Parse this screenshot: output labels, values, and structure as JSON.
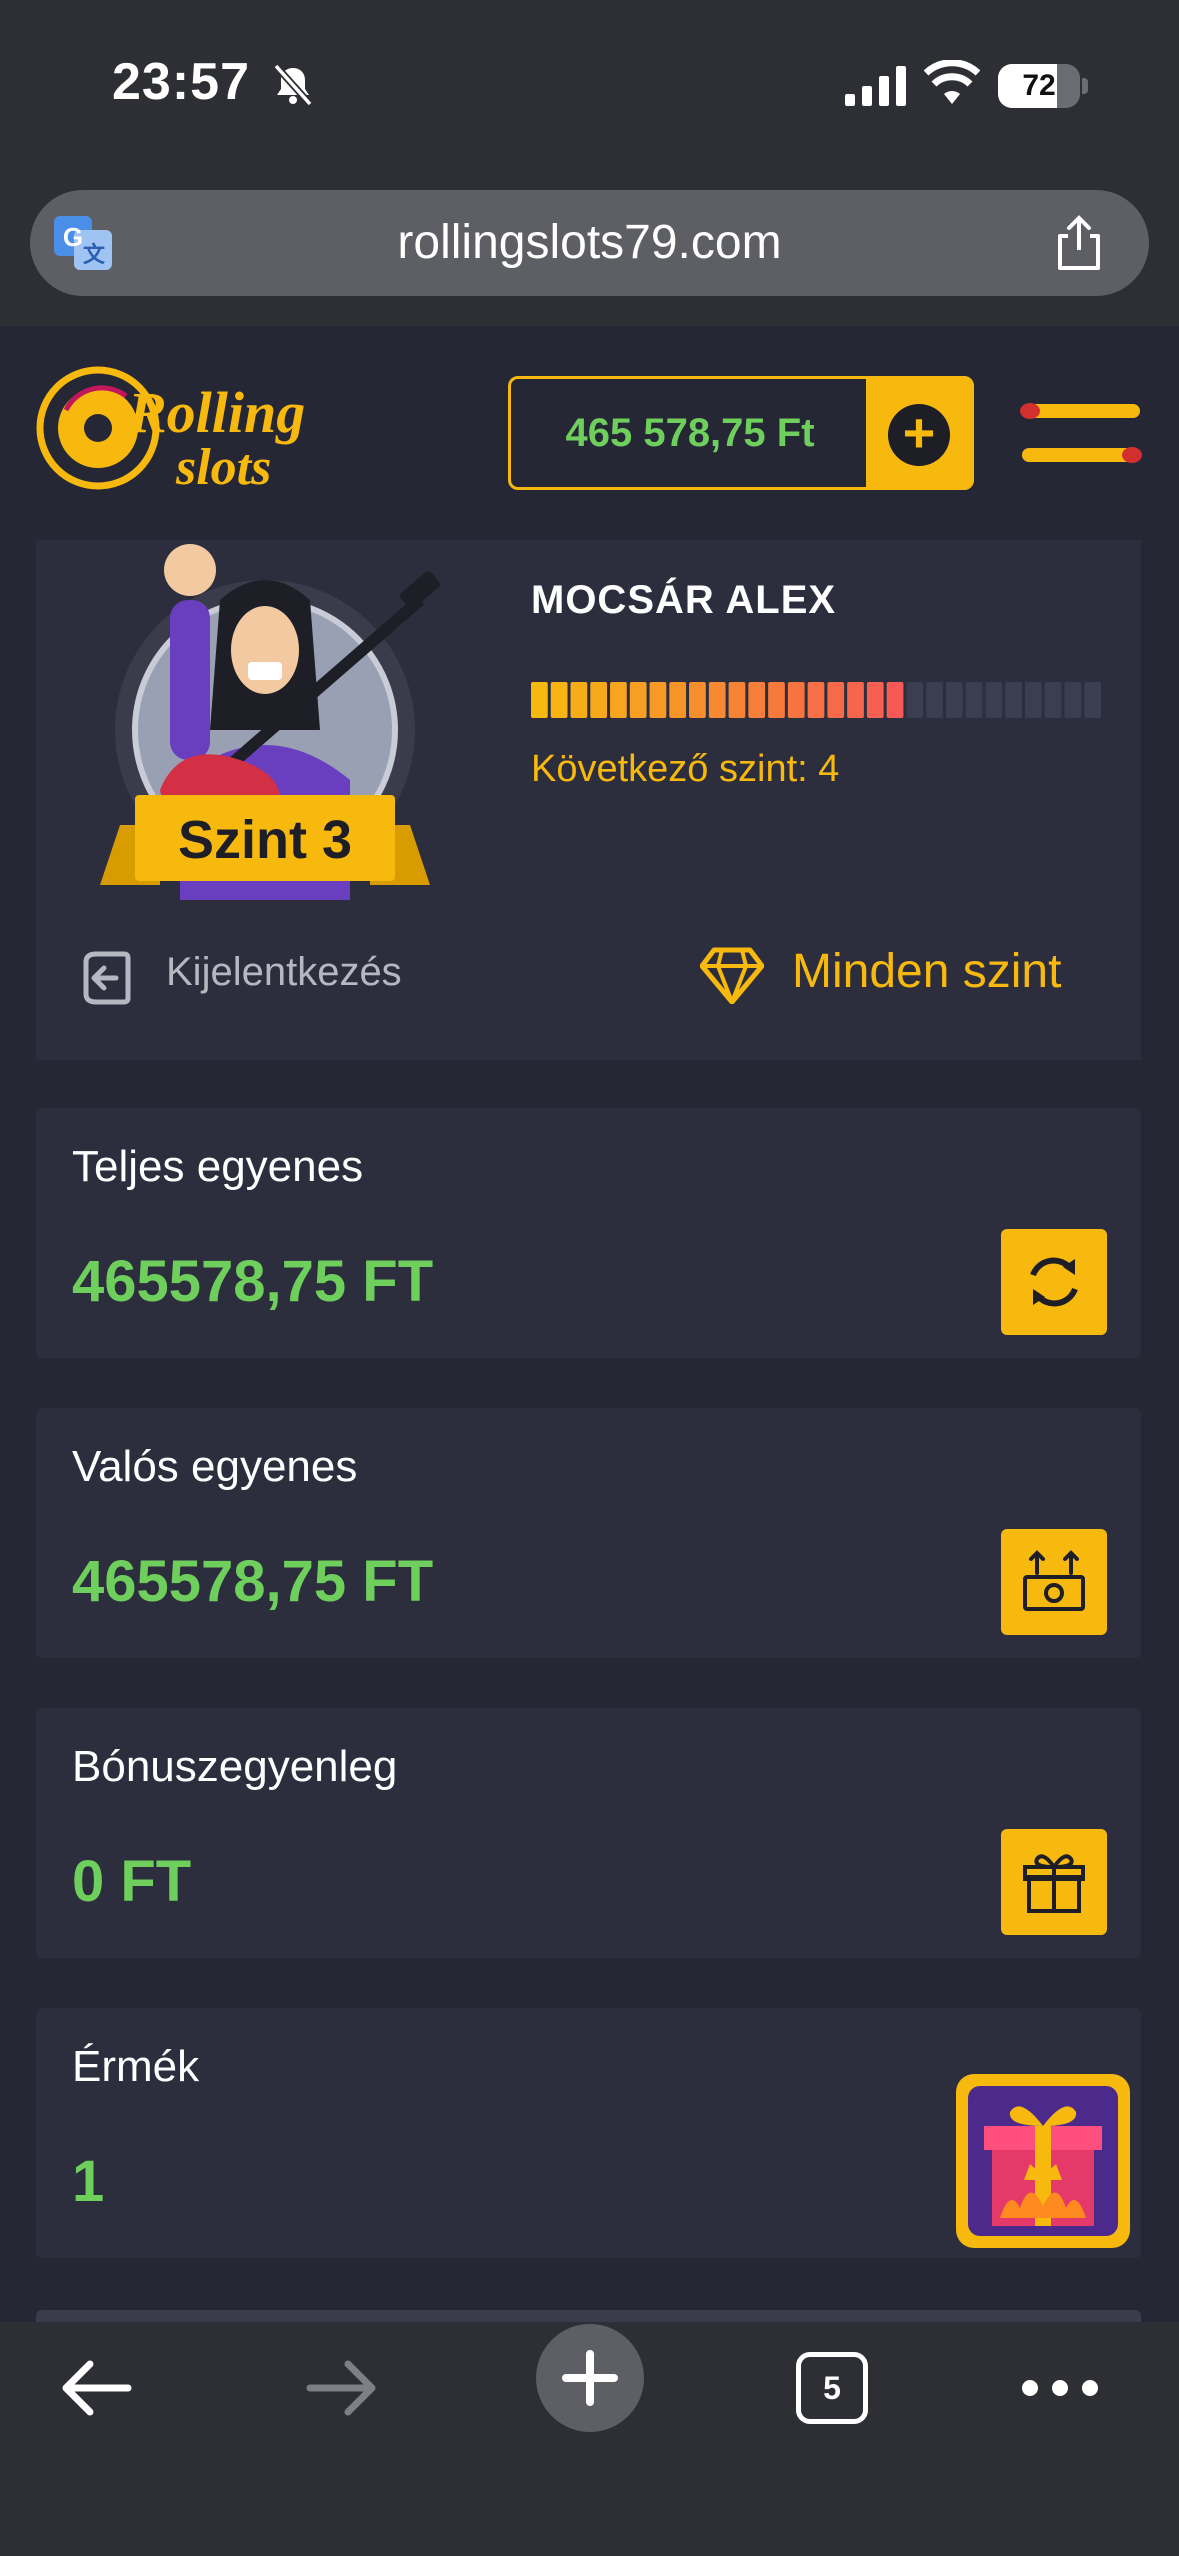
{
  "status_bar": {
    "time": "23:57",
    "battery": "72",
    "battery_level_pct": 72,
    "icons": [
      "bell-slash-icon",
      "signal-icon",
      "wifi-icon",
      "battery-icon"
    ]
  },
  "browser": {
    "url": "rollingslots79.com",
    "icons": [
      "translate-icon",
      "share-icon"
    ]
  },
  "header": {
    "logo_line1": "Rolling",
    "logo_line2": "slots",
    "balance": "465 578,75 Ft",
    "deposit_icon": "plus-icon",
    "menu_icon": "menu-icon"
  },
  "profile": {
    "level_badge": "Szint 3",
    "name": "MOCSÁR ALEX",
    "progress_filled_segments": 19,
    "progress_total_segments": 29,
    "next_level": "Következő szint: 4",
    "logout_label": "Kijelentkezés",
    "all_levels_label": "Minden szint"
  },
  "cards": [
    {
      "label": "Teljes egyenes",
      "value": "465578,75 FT",
      "icon": "refresh-icon"
    },
    {
      "label": "Valós egyenes",
      "value": "465578,75 FT",
      "icon": "cash-withdraw-icon"
    },
    {
      "label": "Bónuszegyenleg",
      "value": "0 FT",
      "icon": "gift-icon"
    },
    {
      "label": "Érmék",
      "value": "1",
      "icon": "gift-box-widget"
    }
  ],
  "toolbar": {
    "tabs_count": "5",
    "icons": [
      "back-arrow-icon",
      "forward-arrow-icon",
      "new-tab-icon",
      "tabs-icon",
      "more-icon"
    ]
  },
  "colors": {
    "accent": "#f7b90e",
    "positive": "#6fcf5d",
    "background": "#252735",
    "card": "#2c2e3d"
  }
}
